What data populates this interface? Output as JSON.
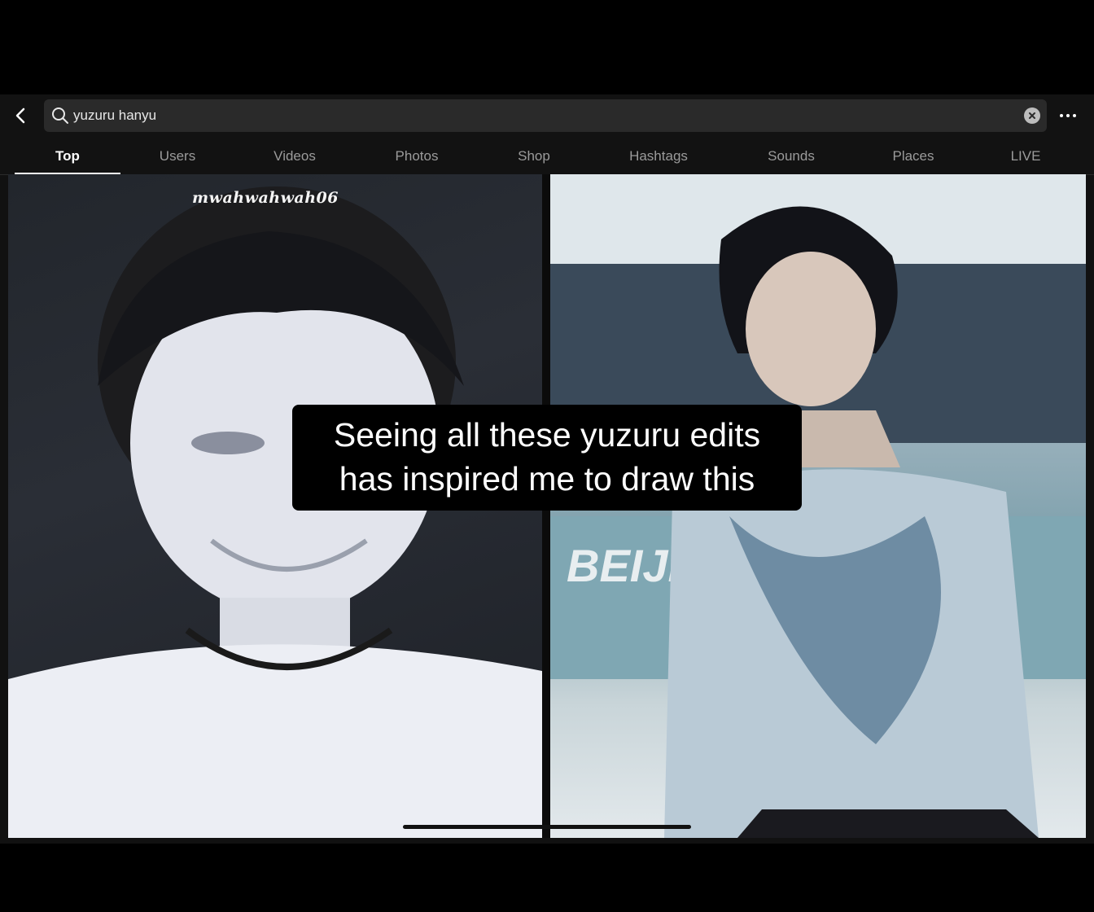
{
  "search": {
    "value": "yuzuru hanyu"
  },
  "tabs": [
    {
      "label": "Top",
      "active": true
    },
    {
      "label": "Users",
      "active": false
    },
    {
      "label": "Videos",
      "active": false
    },
    {
      "label": "Photos",
      "active": false
    },
    {
      "label": "Shop",
      "active": false
    },
    {
      "label": "Hashtags",
      "active": false
    },
    {
      "label": "Sounds",
      "active": false
    },
    {
      "label": "Places",
      "active": false
    },
    {
      "label": "LIVE",
      "active": false
    }
  ],
  "video": {
    "watermark": "mwahwahwah06",
    "caption_line1": "Seeing all these yuzuru edits",
    "caption_line2": "has inspired me to draw this",
    "background_text": "BEIJING 2022"
  },
  "icons": {
    "back": "chevron-left-icon",
    "search": "search-icon",
    "clear": "clear-icon",
    "more": "more-icon"
  }
}
